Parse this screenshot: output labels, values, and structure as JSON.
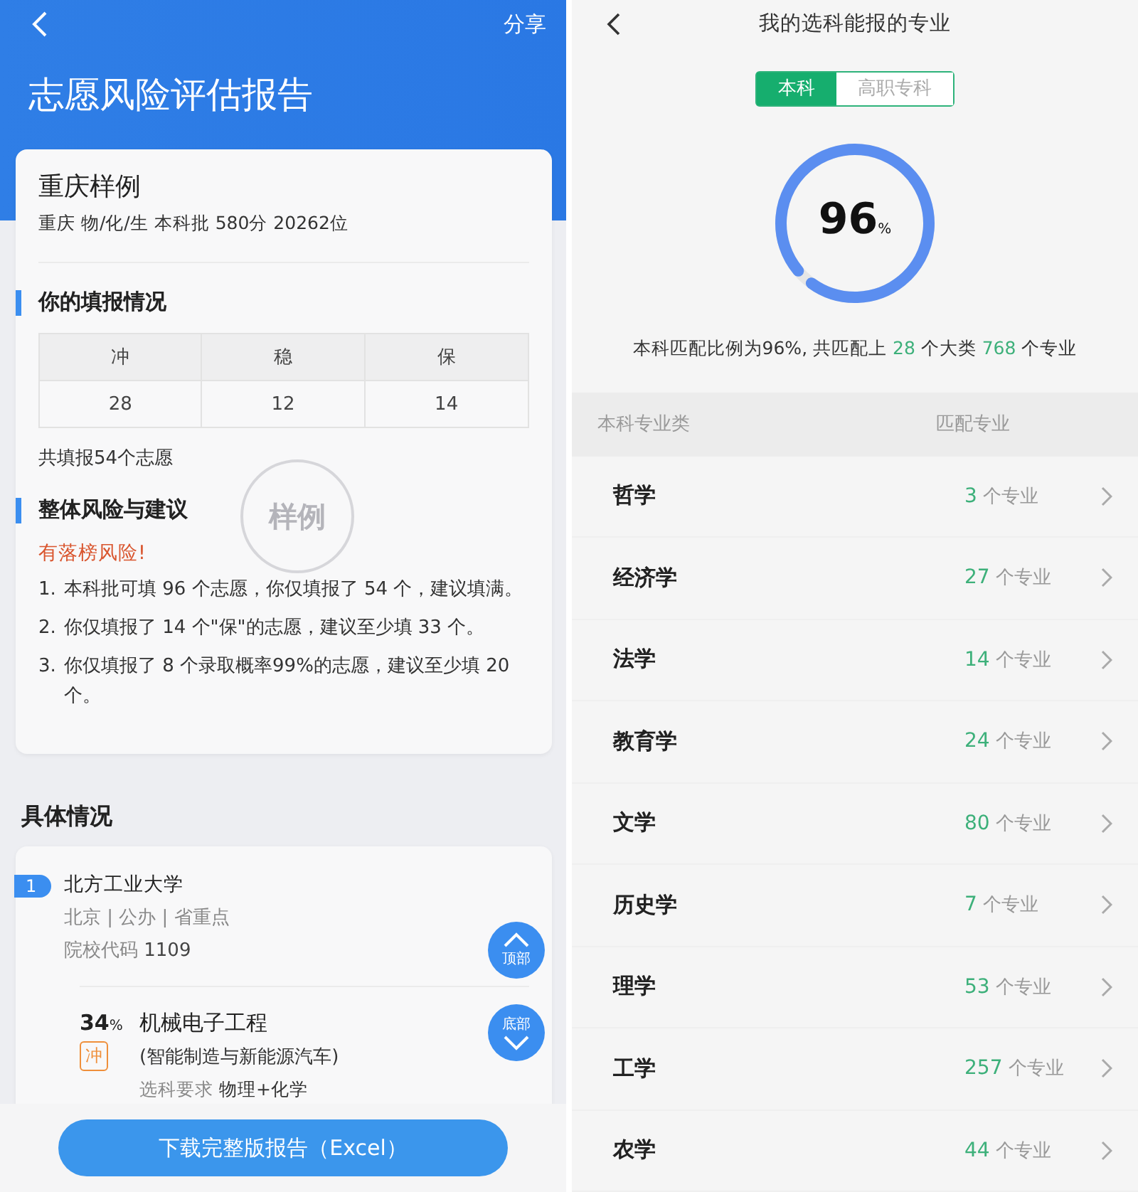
{
  "report": {
    "share": "分享",
    "title": "志愿风险评估报告",
    "profile": {
      "name": "重庆样例",
      "detail": "重庆 物/化/生 本科批 580分 20262位"
    },
    "filling": {
      "heading": "你的填报情况",
      "columns": [
        "冲",
        "稳",
        "保"
      ],
      "values": [
        "28",
        "12",
        "14"
      ],
      "total": "共填报54个志愿"
    },
    "risk": {
      "heading": "整体风险与建议",
      "warning": "有落榜风险!",
      "items": [
        {
          "num": "1.",
          "text": "本科批可填 96 个志愿，你仅填报了 54 个，建议填满。"
        },
        {
          "num": "2.",
          "text": "你仅填报了 14 个\"保\"的志愿，建议至少填 33 个。"
        },
        {
          "num": "3.",
          "text": "你仅填报了 8 个录取概率99%的志愿，建议至少填 20 个。"
        }
      ]
    },
    "stamp": "样例",
    "details": {
      "heading": "具体情况",
      "school": {
        "index": "1",
        "name": "北方工业大学",
        "tags": "北京 | 公办 | 省重点",
        "code": {
          "label": "院校代码",
          "value": "1109"
        }
      },
      "major": {
        "probability": "34",
        "unit": "%",
        "tier": "冲",
        "name": "机械电子工程",
        "note": "(智能制造与新能源汽车)",
        "requirement": {
          "label": "选科要求",
          "value": "物理+化学"
        }
      }
    },
    "float_buttons": [
      {
        "label": "顶部",
        "kind": "up"
      },
      {
        "label": "底部",
        "kind": "down"
      }
    ],
    "download_button": "下载完整版报告（Excel）"
  },
  "majors": {
    "title": "我的选科能报的专业",
    "tabs": [
      {
        "label": "本科",
        "selected": true
      },
      {
        "label": "高职专科",
        "selected": false
      }
    ],
    "ring": {
      "value": "96",
      "unit": "%",
      "level": 0.96
    },
    "summary": [
      {
        "text": "本科匹配比例为96%, 共匹配上 ",
        "highlight": false
      },
      {
        "text": "28",
        "highlight": true
      },
      {
        "text": " 个大类 ",
        "highlight": false
      },
      {
        "text": "768",
        "highlight": true
      },
      {
        "text": " 个专业",
        "highlight": false
      }
    ],
    "columns": [
      "本科专业类",
      "匹配专业"
    ],
    "rows": [
      {
        "name": "哲学",
        "count": "3",
        "unit": "个专业"
      },
      {
        "name": "经济学",
        "count": "27",
        "unit": "个专业"
      },
      {
        "name": "法学",
        "count": "14",
        "unit": "个专业"
      },
      {
        "name": "教育学",
        "count": "24",
        "unit": "个专业"
      },
      {
        "name": "文学",
        "count": "80",
        "unit": "个专业"
      },
      {
        "name": "历史学",
        "count": "7",
        "unit": "个专业"
      },
      {
        "name": "理学",
        "count": "53",
        "unit": "个专业"
      },
      {
        "name": "工学",
        "count": "257",
        "unit": "个专业"
      },
      {
        "name": "农学",
        "count": "44",
        "unit": "个专业"
      }
    ]
  }
}
